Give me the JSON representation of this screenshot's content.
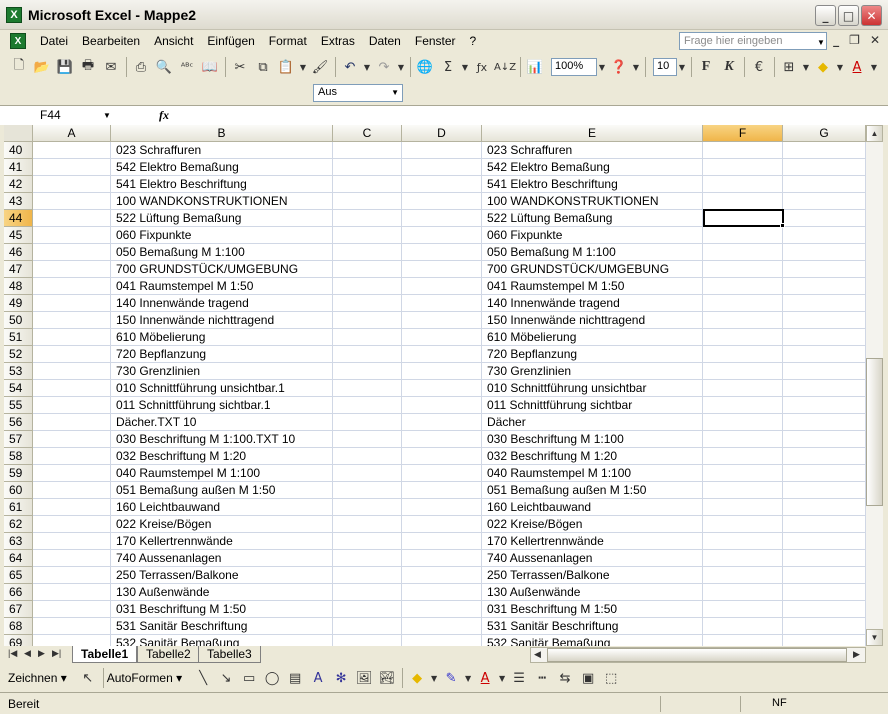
{
  "window": {
    "title": "Microsoft Excel - Mappe2",
    "app_icon": "X"
  },
  "menu": {
    "items": [
      "Datei",
      "Bearbeiten",
      "Ansicht",
      "Einfügen",
      "Format",
      "Extras",
      "Daten",
      "Fenster",
      "?"
    ],
    "help_placeholder": "Frage hier eingeben"
  },
  "toolbar": {
    "zoom": "100%",
    "font_size": "10",
    "bold": "F",
    "italic": "K",
    "currency": "€",
    "icons": [
      "new-icon",
      "open-icon",
      "save-icon",
      "permission-icon",
      "email-icon",
      "print-icon",
      "print-preview-icon",
      "spelling-icon",
      "research-icon",
      "cut-icon",
      "copy-icon",
      "paste-icon",
      "format-painter-icon",
      "undo-icon",
      "redo-icon",
      "hyperlink-icon",
      "autosum-icon",
      "function-icon",
      "sort-icon",
      "chart-wizard-icon",
      "help-icon",
      "borders-icon",
      "fill-color-icon",
      "font-color-icon"
    ]
  },
  "toolbar2": {
    "dropdown_value": "Aus"
  },
  "formula_bar": {
    "name_box": "F44",
    "fx": "fx",
    "content": ""
  },
  "grid": {
    "columns": [
      "A",
      "B",
      "C",
      "D",
      "E",
      "F",
      "G"
    ],
    "active_column": "F",
    "active_row": "44",
    "rows": [
      {
        "n": "40",
        "b": "023 Schraffuren",
        "e": "023 Schraffuren"
      },
      {
        "n": "41",
        "b": "542 Elektro Bemaßung",
        "e": "542 Elektro Bemaßung"
      },
      {
        "n": "42",
        "b": "541 Elektro Beschriftung",
        "e": "541 Elektro Beschriftung"
      },
      {
        "n": "43",
        "b": "100 WANDKONSTRUKTIONEN",
        "e": "100 WANDKONSTRUKTIONEN"
      },
      {
        "n": "44",
        "b": "522 Lüftung Bemaßung",
        "e": "522 Lüftung Bemaßung"
      },
      {
        "n": "45",
        "b": "060 Fixpunkte",
        "e": "060 Fixpunkte"
      },
      {
        "n": "46",
        "b": "050 Bemaßung M 1:100",
        "e": "050 Bemaßung M 1:100"
      },
      {
        "n": "47",
        "b": "700 GRUNDSTÜCK/UMGEBUNG",
        "e": "700 GRUNDSTÜCK/UMGEBUNG"
      },
      {
        "n": "48",
        "b": "041 Raumstempel M 1:50",
        "e": "041 Raumstempel M 1:50"
      },
      {
        "n": "49",
        "b": "140 Innenwände tragend",
        "e": "140 Innenwände tragend"
      },
      {
        "n": "50",
        "b": "150 Innenwände nichttragend",
        "e": "150 Innenwände nichttragend"
      },
      {
        "n": "51",
        "b": "610 Möbelierung",
        "e": "610 Möbelierung"
      },
      {
        "n": "52",
        "b": "720 Bepflanzung",
        "e": "720 Bepflanzung"
      },
      {
        "n": "53",
        "b": "730 Grenzlinien",
        "e": "730 Grenzlinien"
      },
      {
        "n": "54",
        "b": "010 Schnittführung unsichtbar.1",
        "e": "010 Schnittführung unsichtbar"
      },
      {
        "n": "55",
        "b": "011 Schnittführung sichtbar.1",
        "e": "011 Schnittführung sichtbar"
      },
      {
        "n": "56",
        "b": "Dächer.TXT 10",
        "e": "Dächer"
      },
      {
        "n": "57",
        "b": "030 Beschriftung M 1:100.TXT 10",
        "e": "030 Beschriftung M 1:100"
      },
      {
        "n": "58",
        "b": "032 Beschriftung M 1:20",
        "e": "032 Beschriftung M 1:20"
      },
      {
        "n": "59",
        "b": "040 Raumstempel M 1:100",
        "e": "040 Raumstempel M 1:100"
      },
      {
        "n": "60",
        "b": "051 Bemaßung außen M 1:50",
        "e": "051 Bemaßung außen M 1:50"
      },
      {
        "n": "61",
        "b": "160 Leichtbauwand",
        "e": "160 Leichtbauwand"
      },
      {
        "n": "62",
        "b": "022 Kreise/Bögen",
        "e": "022 Kreise/Bögen"
      },
      {
        "n": "63",
        "b": "170 Kellertrennwände",
        "e": "170 Kellertrennwände"
      },
      {
        "n": "64",
        "b": "740 Aussenanlagen",
        "e": "740 Aussenanlagen"
      },
      {
        "n": "65",
        "b": "250 Terrassen/Balkone",
        "e": "250 Terrassen/Balkone"
      },
      {
        "n": "66",
        "b": "130 Außenwände",
        "e": "130 Außenwände"
      },
      {
        "n": "67",
        "b": "031 Beschriftung M 1:50",
        "e": "031 Beschriftung M 1:50"
      },
      {
        "n": "68",
        "b": "531 Sanitär Beschriftung",
        "e": "531 Sanitär Beschriftung"
      },
      {
        "n": "69",
        "b": "532 Sanitär Bemaßung",
        "e": "532 Sanitär Bemaßung"
      }
    ]
  },
  "sheets": {
    "tabs": [
      "Tabelle1",
      "Tabelle2",
      "Tabelle3"
    ],
    "active": "Tabelle1"
  },
  "drawbar": {
    "draw_label": "Zeichnen",
    "autoshapes_label": "AutoFormen"
  },
  "status": {
    "left": "Bereit",
    "right": "NF"
  }
}
